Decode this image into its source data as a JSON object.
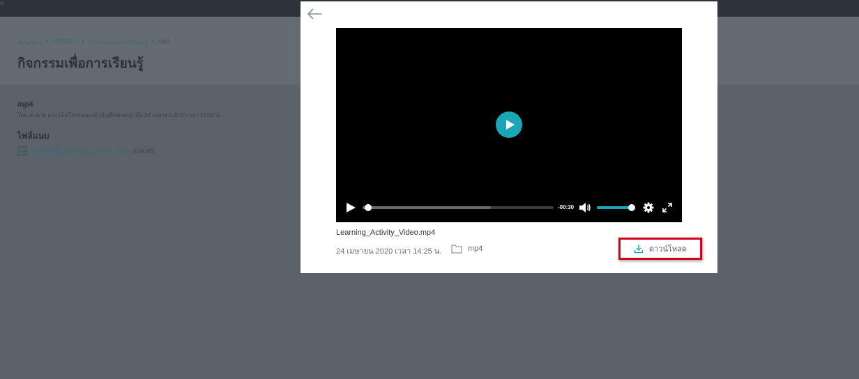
{
  "topbar": {
    "text": "rt"
  },
  "breadcrumb": {
    "items": [
      "ห้องเรียน",
      "INT112-1",
      "กิจกรรมเพื่อการเรียนรู้",
      "mp4"
    ],
    "separator": "/"
  },
  "page": {
    "title": "กิจกรรมเพื่อการเรียนรู้",
    "doc_title": "mp4",
    "doc_meta": "โดย สมชาย แสง เอ็นโวรอนเมนท์ (บัญชีทดสอบ) เมื่อ 24 เมษายน 2020 เวลา 14:25 น.",
    "attachments_heading": "ไฟล์แนบ",
    "attachment": {
      "name": "Learning_Activity_Video.mp4",
      "size": "5.54 MB"
    }
  },
  "modal": {
    "video": {
      "progress": 0.03,
      "buffered": 0.67,
      "time_remaining": "-00:30",
      "volume": 1.0
    },
    "file_name": "Learning_Activity_Video.mp4",
    "date": "24 เมษายน 2020 เวลา 14:25 น.",
    "file_type": "mp4",
    "download_label": "ดาวน์โหลด"
  },
  "colors": {
    "accent": "#1aa6b7",
    "highlight": "#d0021b"
  },
  "icons": {
    "back": "back-arrow-icon",
    "play": "play-icon",
    "volume": "volume-icon",
    "settings": "gear-icon",
    "fullscreen": "fullscreen-icon",
    "folder": "folder-icon",
    "download": "download-icon",
    "file": "file-icon"
  }
}
